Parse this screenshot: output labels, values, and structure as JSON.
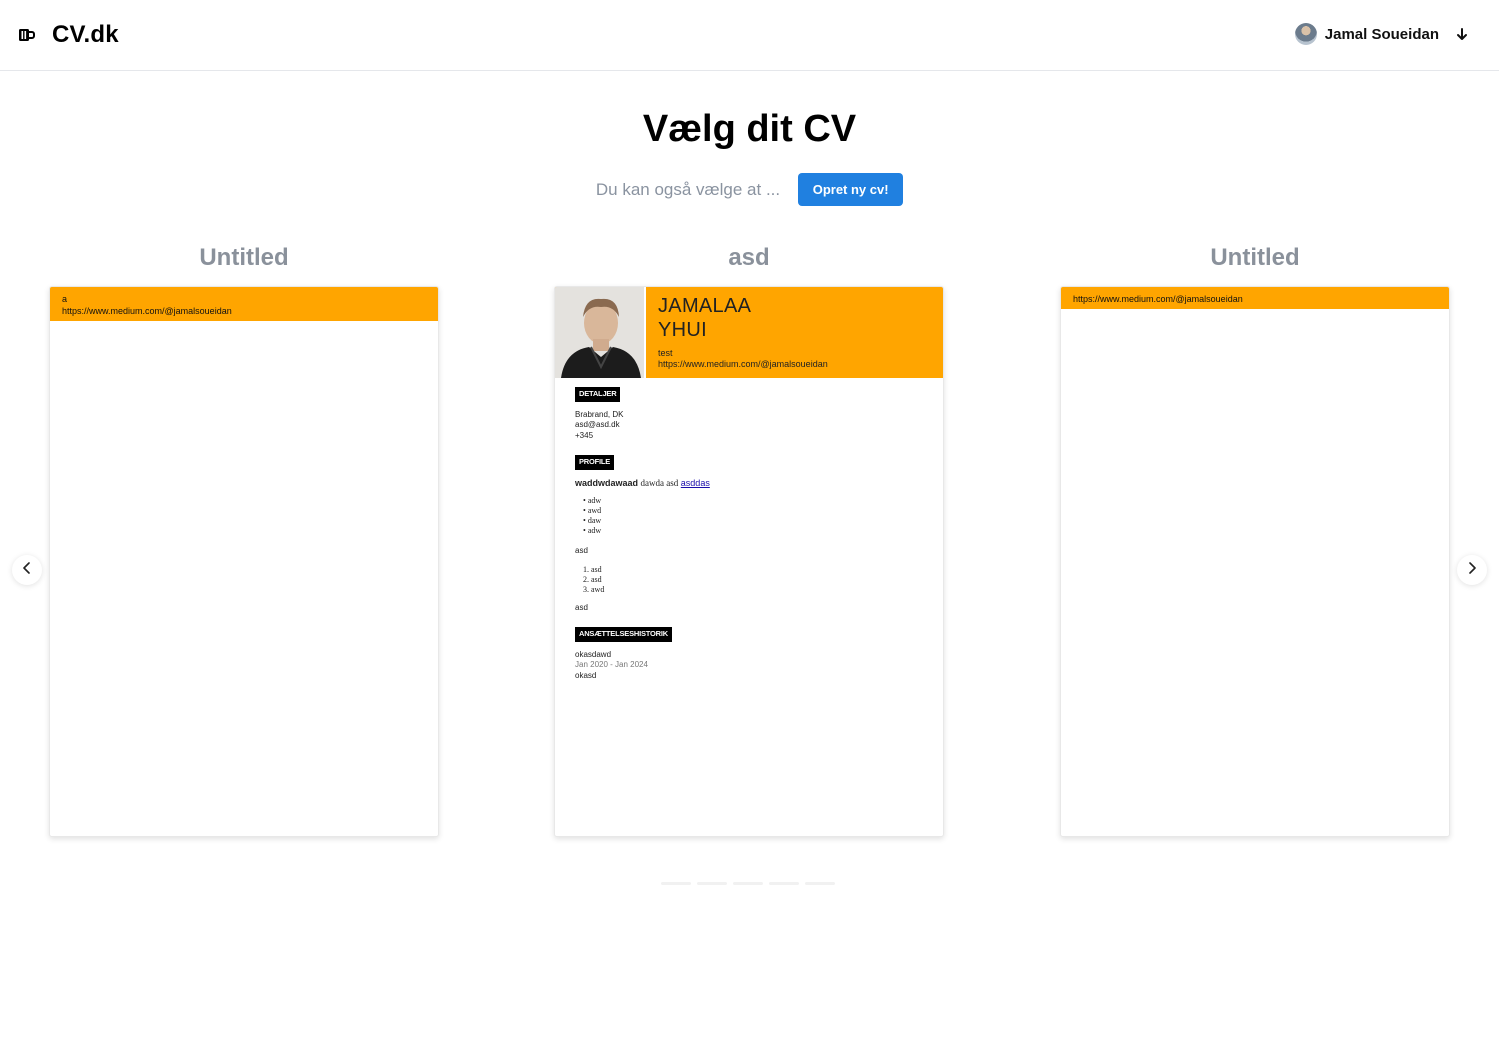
{
  "header": {
    "brand": "CV.dk",
    "user_name": "Jamal Soueidan"
  },
  "main": {
    "title": "Vælg dit CV",
    "subtitle": "Du kan også vælge at ...",
    "create_button": "Opret ny cv!"
  },
  "cards": [
    {
      "title": "Untitled",
      "header_line1": "a",
      "header_line2": "https://www.medium.com/@jamalsoueidan"
    },
    {
      "title": "asd",
      "name_line1": "JAMALAA",
      "name_line2": "YHUI",
      "subtitle": "test",
      "url": "https://www.medium.com/@jamalsoueidan",
      "details_label": "DETALJER",
      "details": [
        "Brabrand, DK",
        "asd@asd.dk",
        "+345"
      ],
      "profile_label": "PROFILE",
      "profile_bold": "waddwdawaad",
      "profile_text": "dawda asd",
      "profile_link": "asddas",
      "bullets": [
        "adw",
        "awd",
        "daw",
        "adw"
      ],
      "para1": "asd",
      "numbered": [
        "asd",
        "asd",
        "awd"
      ],
      "para2": "asd",
      "employment_label": "ANSÆTTELSESHISTORIK",
      "job_title": "okasdawd",
      "job_dates": "Jan 2020 - Jan 2024",
      "job_desc": "okasd"
    },
    {
      "title": "Untitled",
      "header_line1": "https://www.medium.com/@jamalsoueidan"
    }
  ],
  "colors": {
    "accent": "#ffa500",
    "button": "#2080e0",
    "muted_title": "#8a919b"
  },
  "icons": {
    "brand": "beer-mug-icon",
    "user_menu": "arrow-down-icon",
    "prev": "chevron-left-icon",
    "next": "chevron-right-icon"
  }
}
